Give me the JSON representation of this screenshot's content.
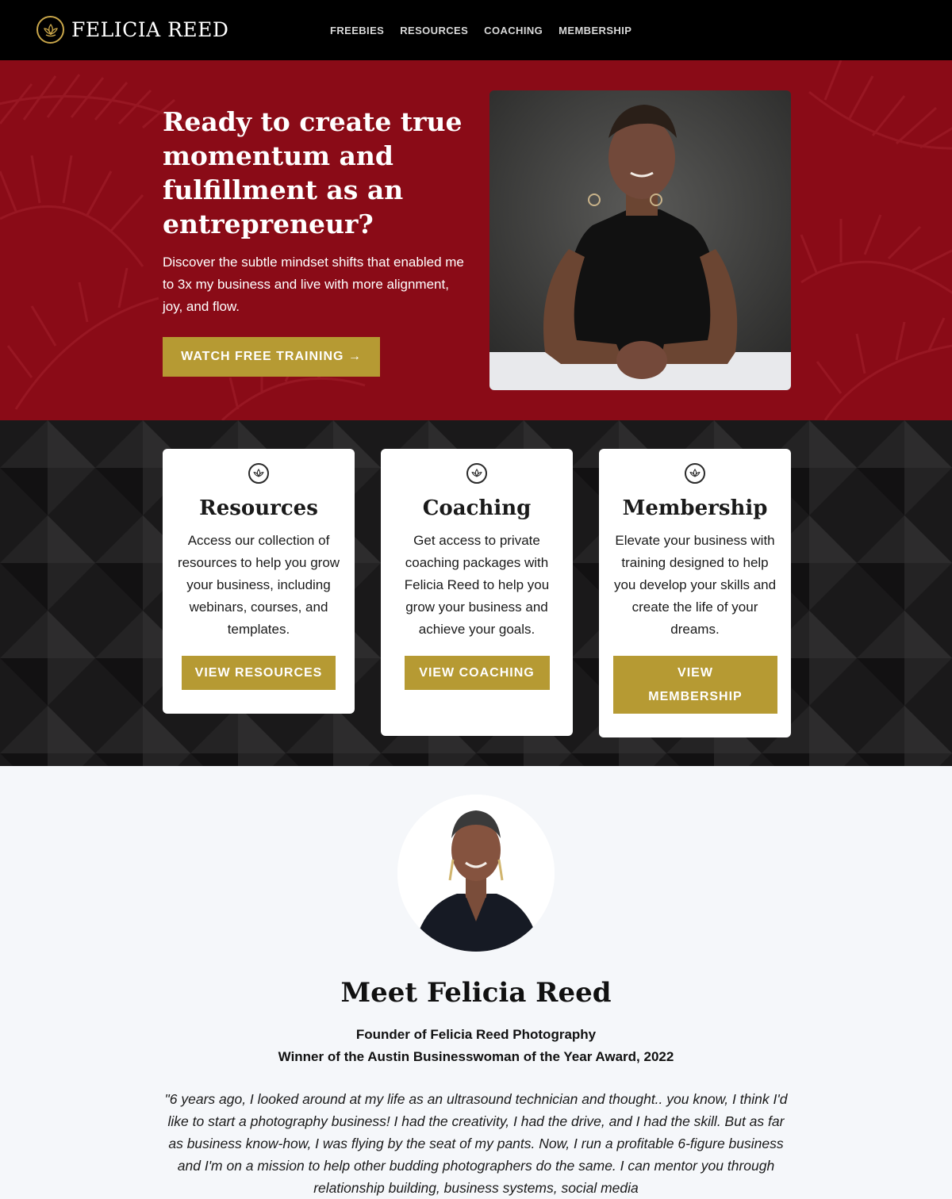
{
  "header": {
    "brand": "FELICIA REED",
    "logo_icon": "lotus-icon",
    "nav": [
      "FREEBIES",
      "RESOURCES",
      "COACHING",
      "MEMBERSHIP"
    ]
  },
  "hero": {
    "title": "Ready to create true momentum and fulfillment as an entrepreneur?",
    "subtitle": "Discover the subtle mindset shifts that enabled me to 3x my business and live with more alignment, joy, and flow.",
    "cta": "WATCH FREE TRAINING →"
  },
  "services": [
    {
      "title": "Resources",
      "text": "Access our collection of resources to help you grow your business, including webinars, courses, and templates.",
      "button": "VIEW RESOURCES"
    },
    {
      "title": "Coaching",
      "text": "Get access to private coaching packages with Felicia Reed to help you grow your business and achieve your goals.",
      "button": "VIEW COACHING"
    },
    {
      "title": "Membership",
      "text": "Elevate your business with training designed to help you develop your skills and create the life of your dreams.",
      "button": "VIEW MEMBERSHIP"
    }
  ],
  "about": {
    "title": "Meet Felicia Reed",
    "credentials": [
      "Founder of Felicia Reed Photography",
      "Winner of the Austin Businesswoman of the Year Award, 2022"
    ],
    "quote": "\"6 years ago, I looked around at my life as an ultrasound technician and thought.. you know, I think I'd like to start a photography business! I had the creativity, I had the drive, and I had the skill. But as far as business know-how, I was flying by the seat of my pants. Now, I run a profitable 6-figure business and I'm on a mission to help other budding photographers do the same. I can mentor you through relationship building, business systems, social media"
  },
  "colors": {
    "header_bg": "#000000",
    "hero_bg": "#8a0b17",
    "gold": "#b69a33",
    "services_bg": "#1c1b1c",
    "about_bg": "#f5f7fa"
  }
}
